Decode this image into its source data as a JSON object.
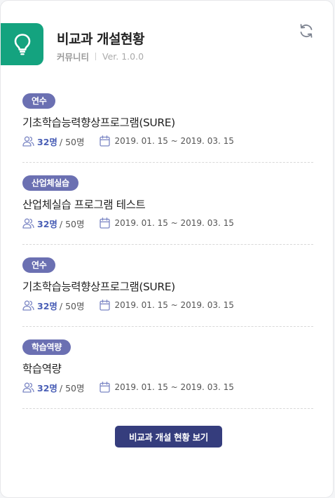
{
  "header": {
    "title": "비교과 개설현황",
    "category": "커뮤니티",
    "version": "Ver. 1.0.0",
    "icon": "lightbulb-icon",
    "accent_color": "#14a37f"
  },
  "programs": [
    {
      "badge": "연수",
      "name": "기초학습능력향상프로그램(SURE)",
      "count": "32명",
      "total": "/ 50명",
      "date": "2019. 01. 15 ~ 2019. 03. 15"
    },
    {
      "badge": "산업체실습",
      "name": "산업체실습 프로그램 테스트",
      "count": "32명",
      "total": "/ 50명",
      "date": "2019. 01. 15 ~ 2019. 03. 15"
    },
    {
      "badge": "연수",
      "name": "기초학습능력향상프로그램(SURE)",
      "count": "32명",
      "total": "/ 50명",
      "date": "2019. 01. 15 ~ 2019. 03. 15"
    },
    {
      "badge": "학습역량",
      "name": "학습역량",
      "count": "32명",
      "total": "/ 50명",
      "date": "2019. 01. 15 ~ 2019. 03. 15"
    }
  ],
  "footer": {
    "button_label": "비교과 개설 현황 보기",
    "button_color": "#353d7d"
  },
  "colors": {
    "badge": "#6b70b2",
    "count": "#4a5fb6"
  }
}
